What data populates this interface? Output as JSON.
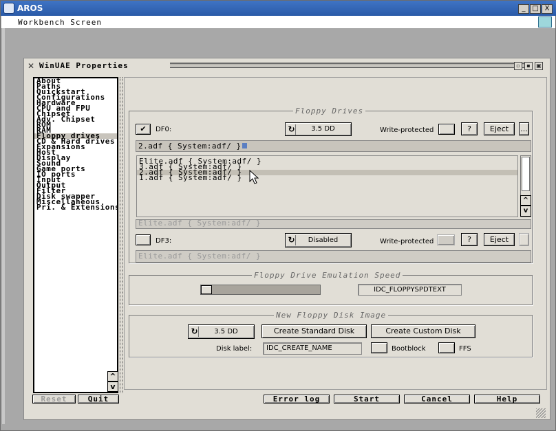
{
  "host": {
    "title": "AROS",
    "menubar_title": "Workbench Screen",
    "window_buttons": [
      "_",
      "□",
      "X"
    ]
  },
  "window": {
    "title": "WinUAE Properties"
  },
  "tree": {
    "items": [
      {
        "label": "About",
        "bold": false
      },
      {
        "label": "Paths",
        "bold": false
      },
      {
        "label": "Quickstart",
        "bold": false
      },
      {
        "label": "Configurations",
        "bold": false
      },
      {
        "label": "Hardware",
        "bold": true
      },
      {
        "label": "CPU and FPU",
        "bold": false
      },
      {
        "label": "Chipset",
        "bold": false
      },
      {
        "label": "Adv. Chipset",
        "bold": false
      },
      {
        "label": "ROM",
        "bold": false
      },
      {
        "label": "RAM",
        "bold": false
      },
      {
        "label": "Floppy drives",
        "bold": false,
        "selected": true
      },
      {
        "label": "CD & Hard drives",
        "bold": false
      },
      {
        "label": "Expansions",
        "bold": false
      },
      {
        "label": "Host",
        "bold": true
      },
      {
        "label": "Display",
        "bold": false
      },
      {
        "label": "Sound",
        "bold": false
      },
      {
        "label": "Game ports",
        "bold": false
      },
      {
        "label": "IO ports",
        "bold": false
      },
      {
        "label": "Input",
        "bold": false
      },
      {
        "label": "Output",
        "bold": false
      },
      {
        "label": "Filter",
        "bold": false
      },
      {
        "label": "Disk swapper",
        "bold": false
      },
      {
        "label": "Miscellaneous",
        "bold": false
      },
      {
        "label": "Pri. & Extensions",
        "bold": false
      }
    ],
    "scroll_up": "^",
    "scroll_down": "v"
  },
  "bottom": {
    "reset": "Reset",
    "quit": "Quit",
    "error_log": "Error log",
    "start": "Start",
    "cancel": "Cancel",
    "help": "Help"
  },
  "floppy": {
    "group_title": "Floppy Drives",
    "df0": {
      "check": "✔",
      "label": "DF0:",
      "type": "3.5 DD",
      "write_protected": "Write-protected",
      "help": "?",
      "eject": "Eject",
      "browse": "...",
      "path": "2.adf { System:adf/ }"
    },
    "list": [
      "Elite.adf { System:adf/ }",
      "3.adf { System:adf/ }",
      "2.adf { System:adf/ }",
      "1.adf { System:adf/ }"
    ],
    "list_selected_index": 2,
    "df1_ghost": "Elite.adf { System:adf/ }",
    "df3": {
      "label": "DF3:",
      "type": "Disabled",
      "write_protected": "Write-protected",
      "help": "?",
      "eject": "Eject",
      "path": "Elite.adf { System:adf/ }"
    }
  },
  "speed": {
    "group_title": "Floppy Drive Emulation Speed",
    "value_text": "IDC_FLOPPYSPDTEXT",
    "slider_position": 0.0
  },
  "newdisk": {
    "group_title": "New Floppy Disk Image",
    "type": "3.5 DD",
    "create_standard": "Create Standard Disk",
    "create_custom": "Create Custom Disk",
    "disk_label_caption": "Disk label:",
    "disk_label_value": "IDC_CREATE_NAME",
    "bootblock": "Bootblock",
    "ffs": "FFS"
  }
}
